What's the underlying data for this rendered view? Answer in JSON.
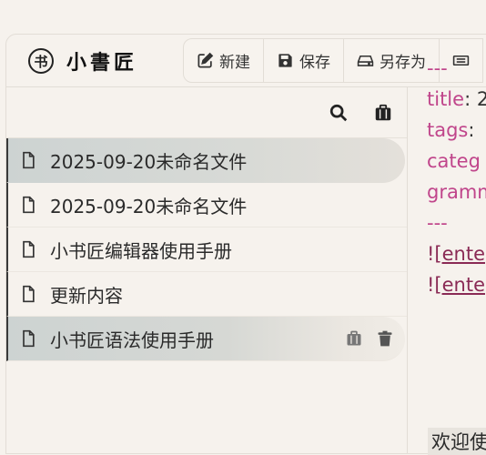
{
  "app": {
    "logo_mark": "书",
    "logo_text": "小書匠"
  },
  "toolbar": {
    "new_label": "新建",
    "save_label": "保存",
    "save_as_label": "另存为"
  },
  "sidebar": {
    "files": [
      {
        "name": "2025-09-20未命名文件",
        "state": "active"
      },
      {
        "name": "2025-09-20未命名文件",
        "state": ""
      },
      {
        "name": "小书匠编辑器使用手册",
        "state": ""
      },
      {
        "name": "更新内容",
        "state": ""
      },
      {
        "name": "小书匠语法使用手册",
        "state": "hover"
      }
    ]
  },
  "editor": {
    "line1": "---",
    "line2_key": "title",
    "line2_rest": ": 2",
    "line3_key": "tags",
    "line3_rest": ":",
    "line4": "categ",
    "line5": "gramm",
    "line6": "---",
    "line7_bang": "!",
    "line7_link": "[ente",
    "line8_bang": "!",
    "line8_link": "[ente",
    "welcome": "欢迎使"
  },
  "colors": {
    "background": "#f6f2ed",
    "active_item": "#cdd3d2",
    "frontmatter": "#c0458b",
    "link": "#8a2a55"
  }
}
